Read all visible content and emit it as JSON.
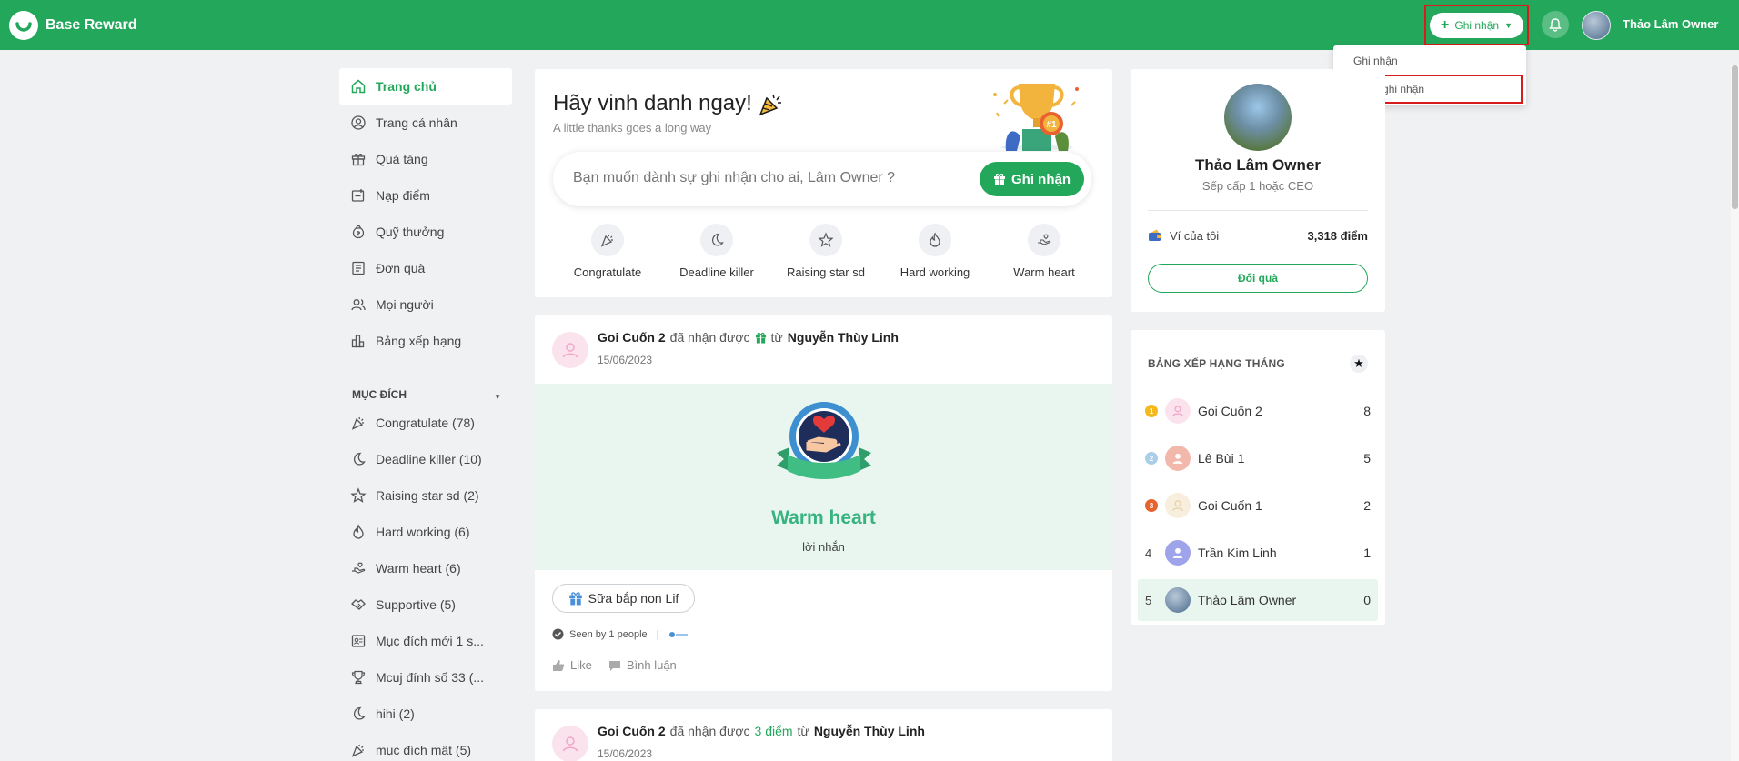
{
  "brand": {
    "name": "Base Reward"
  },
  "header": {
    "record_button": "Ghi nhận",
    "user_name": "Thảo Lâm Owner",
    "menu": {
      "item1": "Ghi nhận",
      "item2": "Nhập ghi nhận"
    }
  },
  "sidebar": {
    "nav": [
      {
        "label": "Trang chủ"
      },
      {
        "label": "Trang cá nhân"
      },
      {
        "label": "Quà tặng"
      },
      {
        "label": "Nạp điểm"
      },
      {
        "label": "Quỹ thưởng"
      },
      {
        "label": "Đơn quà"
      },
      {
        "label": "Mọi người"
      },
      {
        "label": "Bảng xếp hạng"
      }
    ],
    "section_title": "MỤC ĐÍCH",
    "purposes": [
      {
        "label": "Congratulate (78)"
      },
      {
        "label": "Deadline killer (10)"
      },
      {
        "label": "Raising star sd (2)"
      },
      {
        "label": "Hard working (6)"
      },
      {
        "label": "Warm heart (6)"
      },
      {
        "label": "Supportive (5)"
      },
      {
        "label": "Mục đích mới 1 s..."
      },
      {
        "label": "Mcuj đính số 33 (..."
      },
      {
        "label": "hihi (2)"
      },
      {
        "label": "mục đích mật (5)"
      }
    ]
  },
  "hero": {
    "title": "Hãy vinh danh ngay!",
    "subtitle": "A little thanks goes a long way",
    "search_placeholder": "Bạn muốn dành sự ghi nhận cho ai, Lâm Owner ?",
    "button": "Ghi nhận",
    "purposes": [
      {
        "label": "Congratulate"
      },
      {
        "label": "Deadline killer"
      },
      {
        "label": "Raising star sd"
      },
      {
        "label": "Hard working"
      },
      {
        "label": "Warm heart"
      }
    ]
  },
  "post1": {
    "receiver": "Goi Cuốn 2",
    "verb": "đã nhận được",
    "from_word": "từ",
    "sender": "Nguyễn Thùy Linh",
    "date": "15/06/2023",
    "badge_title": "Warm heart",
    "message": "lời nhắn",
    "gift": "Sữa bắp non Lif",
    "seen": "Seen by 1 people",
    "like": "Like",
    "comment": "Bình luận"
  },
  "post2": {
    "receiver": "Goi Cuốn 2",
    "verb": "đã nhận được",
    "points": "3 điểm",
    "from_word": "từ",
    "sender": "Nguyễn Thùy Linh",
    "date": "15/06/2023"
  },
  "profile": {
    "name": "Thảo Lâm Owner",
    "role": "Sếp cấp 1 hoặc CEO",
    "wallet_label": "Ví của tôi",
    "wallet_amount": "3,318 điểm",
    "redeem_button": "Đổi quà"
  },
  "ranking": {
    "title": "BẢNG XẾP HẠNG THÁNG",
    "rows": [
      {
        "rank": "1",
        "name": "Goi Cuốn 2",
        "score": "8"
      },
      {
        "rank": "2",
        "name": "Lê Bùi 1",
        "score": "5"
      },
      {
        "rank": "3",
        "name": "Goi Cuốn 1",
        "score": "2"
      },
      {
        "rank": "4",
        "name": "Trần Kim Linh",
        "score": "1"
      },
      {
        "rank": "5",
        "name": "Thảo Lâm Owner",
        "score": "0"
      }
    ]
  },
  "colors": {
    "brand_green": "#23a85b",
    "accent_teal": "#36b37e",
    "highlight_red": "#d71c1c"
  }
}
